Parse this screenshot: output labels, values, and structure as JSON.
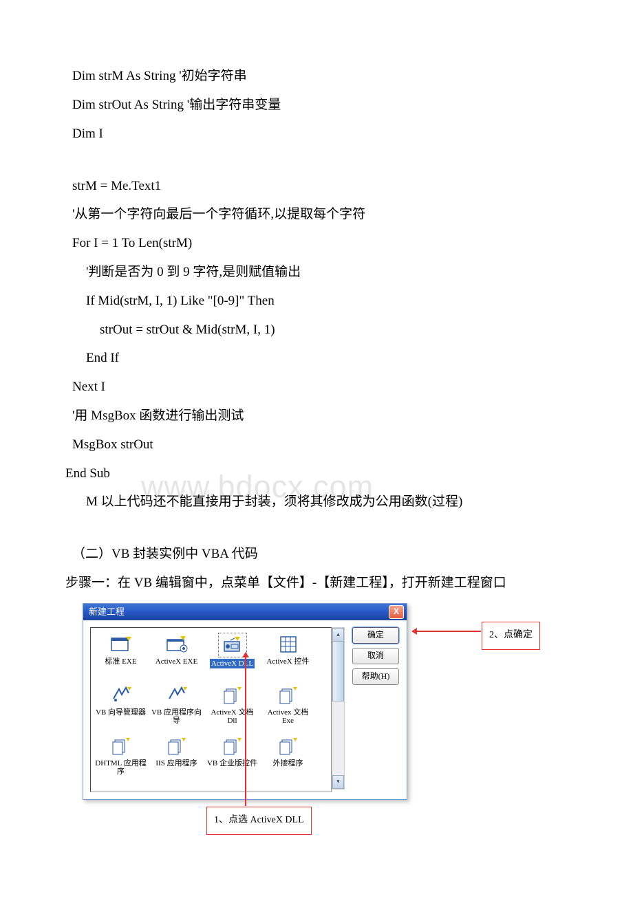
{
  "code": {
    "l1": "Dim strM   As String     '初始字符串",
    "l2": "Dim strOut As String     '输出字符串变量",
    "l3": "Dim I",
    "l4": "strM = Me.Text1",
    "l5": "'从第一个字符向最后一个字符循环,以提取每个字符",
    "l6": "For I = 1 To Len(strM)",
    "l7": "'判断是否为 0 到 9 字符,是则赋值输出",
    "l8": "If Mid(strM, I, 1) Like \"[0-9]\" Then",
    "l9": "strOut = strOut & Mid(strM, I, 1)",
    "l10": "End If",
    "l11": "Next I",
    "l12": "'用 MsgBox 函数进行输出测试",
    "l13": "MsgBox strOut",
    "l14": "End Sub"
  },
  "note": "M 以上代码还不能直接用于封装，须将其修改成为公用函数(过程)",
  "section": "（二）VB 封装实例中 VBA 代码",
  "step": "步骤一：在 VB 编辑窗中，点菜单【文件】-【新建工程】，打开新建工程窗口",
  "watermark": "www.bdocx.com",
  "dialog": {
    "title": "新建工程",
    "close": "X",
    "btn_ok": "确定",
    "btn_cancel": "取消",
    "btn_help": "帮助(H)",
    "items": {
      "i0": "标准 EXE",
      "i1": "ActiveX EXE",
      "i2": "ActiveX DLL",
      "i3": "ActiveX 控件",
      "i4": "VB 向导管理器",
      "i5": "VB 应用程序向导",
      "i6": "ActiveX 文档 Dll",
      "i7": "Activex 文档 Exe",
      "i8": "DHTML 应用程序",
      "i9": "IIS 应用程序",
      "i10": "VB 企业版控件",
      "i11": "外接程序"
    },
    "scroll_up": "▴",
    "scroll_down": "▾"
  },
  "callouts": {
    "c1": "1、点选 ActiveX DLL",
    "c2": "2、点确定"
  }
}
